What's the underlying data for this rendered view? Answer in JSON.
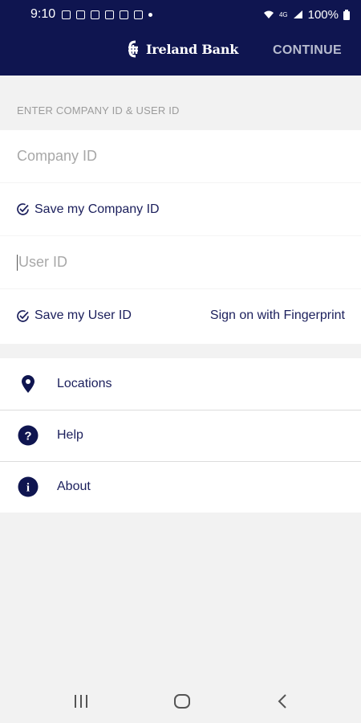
{
  "status_bar": {
    "time": "9:10",
    "battery": "100%",
    "network": "4G"
  },
  "app_bar": {
    "brand_name": "Ireland Bank",
    "continue_label": "CONTINUE"
  },
  "form": {
    "section_title": "ENTER COMPANY ID & USER ID",
    "company_id_placeholder": "Company ID",
    "save_company_id_label": "Save my Company ID",
    "user_id_placeholder": "User ID",
    "save_user_id_label": "Save my User ID",
    "fingerprint_label": "Sign on with Fingerprint"
  },
  "menu": {
    "items": [
      {
        "label": "Locations",
        "icon": "location-pin-icon"
      },
      {
        "label": "Help",
        "icon": "help-icon"
      },
      {
        "label": "About",
        "icon": "info-icon"
      }
    ]
  },
  "colors": {
    "brand_navy": "#0f1550",
    "text_navy": "#1b1f5c",
    "continue_gray": "#b8bccf",
    "background": "#f2f2f2"
  }
}
